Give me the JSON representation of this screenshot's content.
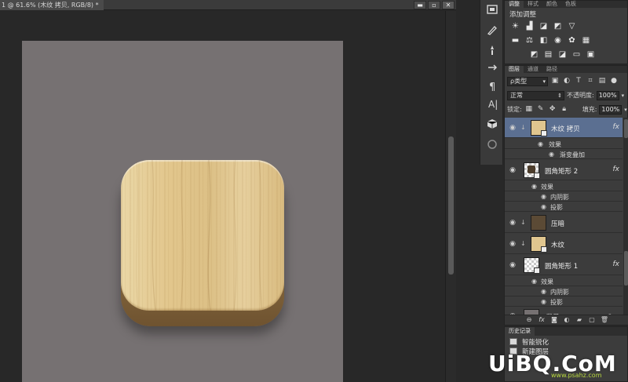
{
  "document": {
    "tab_title": "1 @ 61.6% (木纹 拷贝, RGB/8) *"
  },
  "window_controls": {
    "minimize": "▬",
    "restore": "▫",
    "close": "✕"
  },
  "adjustments_panel": {
    "tabs": [
      "调整",
      "样式",
      "颜色",
      "色板"
    ],
    "title": "添加调整",
    "icons_row1": [
      "brightness-icon",
      "levels-icon",
      "curves-icon",
      "exposure-icon",
      "vibrance-icon"
    ],
    "icons_row2": [
      "hue-saturation-icon",
      "color-balance-icon",
      "black-white-icon",
      "photo-filter-icon",
      "channel-mixer-icon",
      "color-lookup-icon"
    ],
    "icons_row3": [
      "invert-icon",
      "posterize-icon",
      "threshold-icon",
      "gradient-map-icon",
      "selective-color-icon"
    ]
  },
  "layers_panel": {
    "tabs": [
      "图层",
      "通道",
      "路径"
    ],
    "filter_kind": "ρ类型",
    "blend_mode": "正常",
    "opacity_label": "不透明度:",
    "opacity_value": "100%",
    "lock_label": "锁定:",
    "fill_label": "填充:",
    "fill_value": "100%",
    "layers": [
      {
        "name": "木纹 拷贝",
        "selected": true,
        "thumb": "wood",
        "fx": "fx",
        "effects_label": "效果",
        "effects": [
          "渐变叠加"
        ]
      },
      {
        "name": "圆角矩形 2",
        "selected": false,
        "thumb": "checker",
        "fx": "fx",
        "effects_label": "效果",
        "effects": [
          "内阴影",
          "投影"
        ]
      },
      {
        "name": "压暗",
        "selected": false,
        "thumb": "dark"
      },
      {
        "name": "木纹",
        "selected": false,
        "thumb": "wood"
      },
      {
        "name": "圆角矩形 1",
        "selected": false,
        "thumb": "checker",
        "fx": "fx",
        "effects_label": "效果",
        "effects": [
          "内阴影",
          "投影"
        ]
      },
      {
        "name": "背景",
        "selected": false,
        "thumb": "grey",
        "italic": true,
        "locked": true
      }
    ]
  },
  "history_panel": {
    "tabs": [
      "历史记录"
    ],
    "items": [
      "智能锐化",
      "新建图层"
    ]
  },
  "watermark": {
    "brand": "UiBQ.CoM",
    "url": "www.psahz.com"
  }
}
